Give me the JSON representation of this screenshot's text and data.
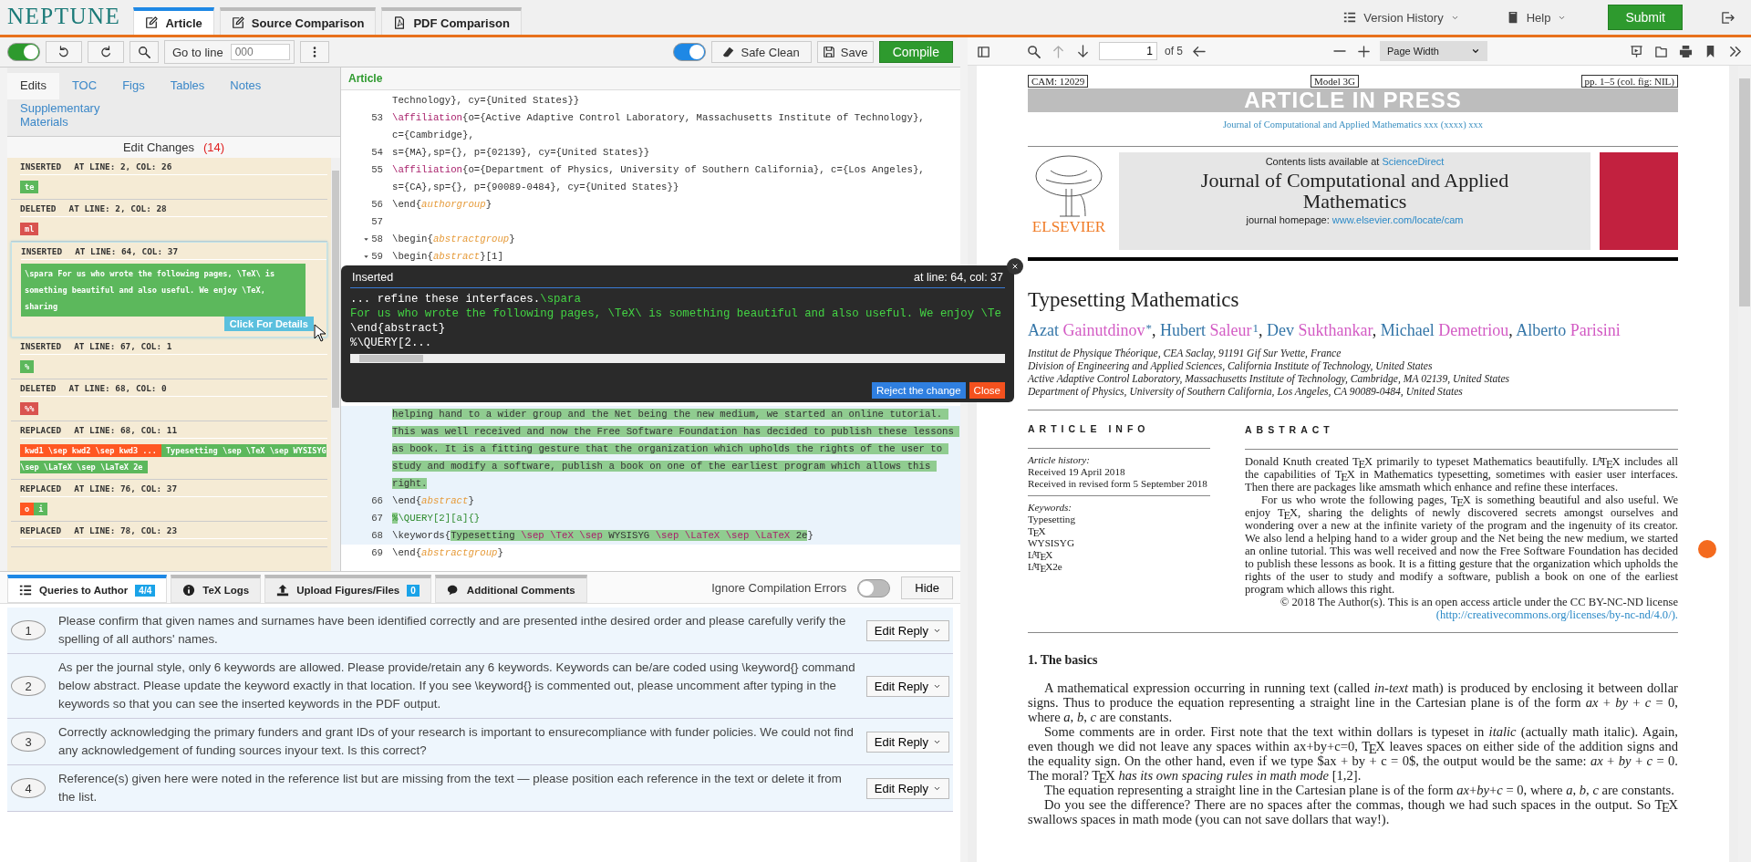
{
  "app": {
    "logo": "NEPTUNE",
    "tabs": [
      {
        "label": "Article",
        "selected": true,
        "kind": "edit"
      },
      {
        "label": "Source Comparison",
        "selected": false,
        "kind": "edit"
      },
      {
        "label": "PDF Comparison",
        "selected": false,
        "kind": "pdf"
      }
    ],
    "menus": [
      {
        "label": "Version History",
        "kind": "list"
      },
      {
        "label": "Help",
        "kind": "book"
      }
    ],
    "submit": "Submit"
  },
  "toolbar": {
    "left_toggle": {
      "on": true
    },
    "goto_label": "Go to line",
    "goto_placeholder": "000",
    "right_toggle": {
      "on": true
    },
    "safe_clean": "Safe Clean",
    "save": "Save",
    "compile": "Compile"
  },
  "sidebar": {
    "tabs": [
      {
        "label": "Edits",
        "selected": true
      },
      {
        "label": "TOC",
        "selected": false
      },
      {
        "label": "Figs",
        "selected": false
      },
      {
        "label": "Tables",
        "selected": false
      },
      {
        "label": "Notes",
        "selected": false
      },
      {
        "label": "Supplementary Materials",
        "selected": false
      }
    ],
    "heading": "Edit Changes",
    "count": "(14)",
    "changes": [
      {
        "type": "INSERTED",
        "position": "AT LINE: 2, COL: 26",
        "selected": false,
        "tokens": [
          {
            "text": "te",
            "kind": "inserted"
          }
        ]
      },
      {
        "type": "DELETED",
        "position": "AT LINE: 2, COL: 28",
        "selected": false,
        "tokens": [
          {
            "text": "ml",
            "kind": "deleted"
          }
        ]
      },
      {
        "type": "INSERTED",
        "position": "AT LINE: 64, COL: 37",
        "selected": true,
        "tokens": [
          {
            "text": "\\spara For us who wrote the following pages, \\TeX\\ is something beautiful and also useful. We enjoy \\TeX, sharing",
            "kind": "inserted"
          }
        ],
        "details_button": "Click For Details"
      },
      {
        "type": "INSERTED",
        "position": "AT LINE: 67, COL: 1",
        "selected": false,
        "tokens": [
          {
            "text": "%",
            "kind": "inserted"
          }
        ]
      },
      {
        "type": "DELETED",
        "position": "AT LINE: 68, COL: 0",
        "selected": false,
        "tokens": [
          {
            "text": "%%",
            "kind": "deleted"
          }
        ]
      },
      {
        "type": "REPLACED",
        "position": "AT LINE: 68, COL: 11",
        "selected": false,
        "tokens": [
          {
            "text": "kwd1 \\sep kwd2 \\sep kwd3 ...",
            "kind": "replaced"
          },
          {
            "text": "Typesetting \\sep \\TeX \\sep WYSISYG \\sep \\LaTeX \\sep \\LaTeX 2e",
            "kind": "inserted"
          }
        ]
      },
      {
        "type": "REPLACED",
        "position": "AT LINE: 76, COL: 37",
        "selected": false,
        "tokens": [
          {
            "text": "o",
            "kind": "replaced"
          },
          {
            "text": "i",
            "kind": "inserted"
          }
        ]
      },
      {
        "type": "REPLACED",
        "position": "AT LINE: 78, COL: 23",
        "selected": false
      }
    ]
  },
  "editor": {
    "title": "Article",
    "lines_above": [
      {
        "segments": [
          {
            "text": "Technology}, cy={United States}}",
            "kind": "plain"
          }
        ]
      },
      {
        "number": "53",
        "segments": [
          {
            "text": "\\affiliation",
            "kind": "command"
          },
          {
            "text": "{o={Active Adaptive Control Laboratory, Massachusetts Institute of Technology}, c={Cambridge},",
            "kind": "plain"
          }
        ]
      },
      {
        "number": "54",
        "segments": [
          {
            "text": "s={MA},sp={}, p={02139}, cy={United States}}",
            "kind": "plain"
          }
        ]
      },
      {
        "number": "55",
        "segments": [
          {
            "text": "\\affiliation",
            "kind": "command"
          },
          {
            "text": "{o={Department of Physics, University of Southern California}, c={Los Angeles}, s={CA},sp={}, p={90089-0484}, cy={United States}}",
            "kind": "plain"
          }
        ]
      },
      {
        "number": "56",
        "segments": [
          {
            "text": "\\end{",
            "kind": "plain"
          },
          {
            "text": "authorgroup",
            "kind": "env"
          },
          {
            "text": "}",
            "kind": "plain"
          }
        ]
      },
      {
        "number": "57"
      },
      {
        "number": "58",
        "foldable": true,
        "segments": [
          {
            "text": "\\begin{",
            "kind": "plain"
          },
          {
            "text": "abstractgroup",
            "kind": "env"
          },
          {
            "text": "}",
            "kind": "plain"
          }
        ]
      },
      {
        "number": "59",
        "foldable": true,
        "segments": [
          {
            "text": "\\begin{",
            "kind": "plain"
          },
          {
            "text": "abstract",
            "kind": "env"
          },
          {
            "text": "}[1]",
            "kind": "plain"
          }
        ]
      }
    ],
    "lines_below": [
      {
        "active": true,
        "segments": [
          {
            "text": "helping hand to a wider group and the Net being the new medium, we started an online tutorial. This was well received and now the Free Software Foundation has decided to publish these lessons as book. It is a fitting gesture that the organization which upholds the rights of the user to study and modify a software, publish a book on one of the earliest program which allows this right.",
            "kind": "plain",
            "inserted": true
          }
        ]
      },
      {
        "number": "66",
        "active": true,
        "segments": [
          {
            "text": "\\end{",
            "kind": "plain"
          },
          {
            "text": "abstract",
            "kind": "env"
          },
          {
            "text": "}",
            "kind": "plain"
          }
        ]
      },
      {
        "number": "67",
        "active": true,
        "segments": [
          {
            "text": "%",
            "kind": "comment",
            "inserted": true
          },
          {
            "text": "\\QUERY[2][a]{}",
            "kind": "comment"
          }
        ]
      },
      {
        "number": "68",
        "active": true,
        "segments": [
          {
            "text": "\\keywords{",
            "kind": "plain"
          },
          {
            "text": "Typesetting ",
            "kind": "plain",
            "inserted": true
          },
          {
            "text": "\\sep \\TeX \\sep",
            "kind": "command",
            "inserted": true
          },
          {
            "text": " WYSISYG ",
            "kind": "plain",
            "inserted": true
          },
          {
            "text": "\\sep \\LaTeX \\sep \\LaTeX",
            "kind": "command",
            "inserted": true
          },
          {
            "text": " 2e",
            "kind": "plain",
            "inserted": true
          },
          {
            "text": "}",
            "kind": "plain"
          }
        ]
      },
      {
        "number": "69",
        "segments": [
          {
            "text": "\\end{",
            "kind": "plain"
          },
          {
            "text": "abstractgroup",
            "kind": "env"
          },
          {
            "text": "}",
            "kind": "plain"
          }
        ]
      }
    ]
  },
  "popup": {
    "title": "Inserted",
    "position": "at line: 64, col: 37",
    "lines": [
      {
        "segments": [
          {
            "text": "... refine these interfaces.",
            "kind": "plain"
          },
          {
            "text": "\\spara",
            "kind": "inserted"
          }
        ]
      },
      {
        "segments": [
          {
            "text": "For us who wrote the following pages, \\TeX\\ is something beautiful and also useful. We enjoy \\Te",
            "kind": "inserted"
          }
        ]
      },
      {
        "segments": [
          {
            "text": "\\end{abstract}",
            "kind": "plain"
          }
        ]
      },
      {
        "segments": [
          {
            "text": "%\\QUERY[2...",
            "kind": "plain"
          }
        ]
      }
    ],
    "reject": "Reject the change",
    "close": "Close"
  },
  "bottom": {
    "tabs": [
      {
        "label": "Queries to Author",
        "badge": "4/4",
        "selected": true,
        "kind": "list"
      },
      {
        "label": "TeX Logs",
        "selected": false,
        "kind": "info"
      },
      {
        "label": "Upload Figures/Files",
        "badge": "0",
        "selected": false,
        "kind": "upload"
      },
      {
        "label": "Additional Comments",
        "selected": false,
        "kind": "comments"
      }
    ],
    "ignore_errors": {
      "label": "Ignore Compilation Errors",
      "on": false
    },
    "hide": "Hide",
    "queries": [
      {
        "number": "1",
        "text": "Please confirm that given names and surnames have been identified correctly and are presented inthe desired order and please carefully verify the spelling of all authors' names.",
        "action": "Edit Reply"
      },
      {
        "number": "2",
        "text": "As per the journal style, only 6 keywords are allowed. Please provide/retain any 6 keywords. Keywords can be/are coded using \\keyword{} command below abstract. Please update the keyword exactly in that location. If you see \\keyword{} is commented out, please uncomment after typing in the keywords so that you can see the inserted keywords in the PDF output.",
        "action": "Edit Reply"
      },
      {
        "number": "3",
        "text": "Correctly acknowledging the primary funders and grant IDs of your research is important to ensurecompliance with funder policies. We could not find any acknowledgement of funding sources inyour text. Is this correct?",
        "action": "Edit Reply"
      },
      {
        "number": "4",
        "text": "Reference(s) given here were noted in the reference list but are missing from the text — please position each reference in the text or delete it from the list.",
        "action": "Edit Reply"
      }
    ]
  },
  "pdf": {
    "toolbar": {
      "page": "1",
      "page_count": "of 5",
      "zoom": "Page Width"
    },
    "page": {
      "header_left": "CAM: 12029",
      "header_center": "Model 3G",
      "header_right": "pp. 1–5 (col. fig: NIL)",
      "banner": "ARTICLE IN PRESS",
      "journal_ref": "Journal of Computational and Applied Mathematics xxx (xxxx) xxx",
      "publisher": "ELSEVIER",
      "contents_label": "Contents lists available at",
      "contents_link": "ScienceDirect",
      "journal_title": "Journal of Computational and Applied Mathematics",
      "homepage_label": "journal homepage:",
      "homepage_link": "www.elsevier.com/locate/cam",
      "title": "Typesetting Mathematics",
      "authors": [
        {
          "given": "Azat",
          "family": "Gainutdinov",
          "mark": "*",
          "sep": ","
        },
        {
          "given": "Hubert",
          "family": "Saleur",
          "mark": "1",
          "sep": ","
        },
        {
          "given": "Dev",
          "family": "Sukthankar",
          "sep": ","
        },
        {
          "given": "Michael",
          "family": "Demetriou",
          "sep": ","
        },
        {
          "given": "Alberto",
          "family": "Parisini"
        }
      ],
      "affiliations": [
        "Institut de Physique Théorique, CEA Saclay, 91191 Gif Sur Yvette, France",
        "Division of Engineering and Applied Sciences, California Institute of Technology, United States",
        "Active Adaptive Control Laboratory, Massachusetts Institute of Technology, Cambridge, MA 02139, United States",
        "Department of Physics, University of Southern California, Los Angeles, CA 90089-0484, United States"
      ],
      "info_heading": "ARTICLE INFO",
      "history_label": "Article history:",
      "history": [
        "Received 19 April 2018",
        "Received in revised form 5 September 2018"
      ],
      "keywords_label": "Keywords:",
      "keywords": [
        "Typesetting",
        "T$_{E}$X",
        "WYSISYG",
        "L$^{A}$T$_{E}$X",
        "L$^{A}$T$_{E}$X2e"
      ],
      "abstract_heading": "ABSTRACT",
      "abstract": [
        "Donald Knuth created T$_{E}$X primarily to typeset Mathematics beautifully. L$^{A}$T$_{E}$X includes all the capabilities of T$_{E}$X in Mathematics typesetting, sometimes with easier user interfaces. Then there are packages like amsmath which enhance and refine these interfaces.",
        "For us who wrote the following pages, T$_{E}$X is something beautiful and also useful. We enjoy T$_{E}$X, sharing the delights of newly discovered secrets amongst ourselves and wondering over a new at the infinite variety of the program and the ingenuity of its creator. We also lend a helping hand to a wider group and the Net being the new medium, we started an online tutorial. This was well received and now the Free Software Foundation has decided to publish these lessons as book. It is a fitting gesture that the organization which upholds the rights of the user to study and modify a software, publish a book on one of the earliest program which allows this right."
      ],
      "license": "© 2018 The Author(s). This is an open access article under the CC BY-NC-ND license",
      "license_link": "(http://creativecommons.org/licenses/by-nc-nd/4.0/).",
      "section": "1.  The basics",
      "body": [
        "A mathematical expression occurring in running text (called *in-text* math) is produced by enclosing it between dollar signs. Thus to produce the equation representing a straight line in the Cartesian plane is of the form *ax* + *by* + *c* = 0, where *a*, *b*, *c* are constants.",
        "Some comments are in order. First note that the text within dollars is typeset in *italic* (actually math italic). Again, even though we did not leave any spaces within ax+by+c=0, T$_{E}$X leaves spaces on either side of the addition signs and the equality sign. On the other hand, even if we type $ax + by + c = 0$, the output would be the same: *ax* + *by* + *c* = 0. The moral? T$_{E}$X *has its own spacing rules in math mode* [1,2].",
        "The equation representing a straight line in the Cartesian plane is of the form *ax*+*by*+*c* = 0, where *a*, *b*, *c* are constants.",
        "Do you see the difference? There are no spaces after the commas, though we had such spaces in the output. So T$_{E}$X swallows spaces in math mode (you can not save dollars that way!)."
      ]
    }
  }
}
